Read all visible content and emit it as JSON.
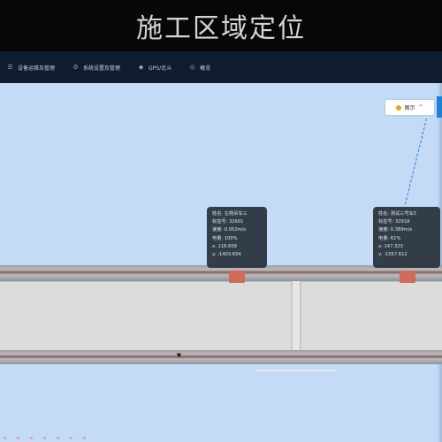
{
  "header": {
    "title": "施工区域定位"
  },
  "nav": {
    "items": [
      {
        "label": "设备运维及管理",
        "icon": "list-icon"
      },
      {
        "label": "系统设置及管理",
        "icon": "settings-icon"
      },
      {
        "label": "GPS/北斗",
        "icon": "location-icon"
      },
      {
        "label": "概览",
        "icon": "overview-icon"
      }
    ]
  },
  "map": {
    "legend": {
      "label": "图示",
      "chevron": "^"
    },
    "devices": [
      {
        "name": "姓名: 左侧吊车三",
        "tag": "标签号: 32601",
        "speed": "速度: 0.052m/s",
        "battery": "电量: 100%",
        "x": "x: 116.609",
        "y": "y: -1403.654"
      },
      {
        "name": "姓名: 测试三号车5",
        "tag": "标签号: 32918",
        "speed": "速度: 0.389m/s",
        "battery": "电量: 61%",
        "x": "x: 147.323",
        "y": "y: -1557.612"
      }
    ]
  },
  "colors": {
    "map_bg": "#c3dbf5",
    "nav_bg": "#0f1c2e",
    "marker": "#d06a5a",
    "accent": "#1d7fd6"
  }
}
